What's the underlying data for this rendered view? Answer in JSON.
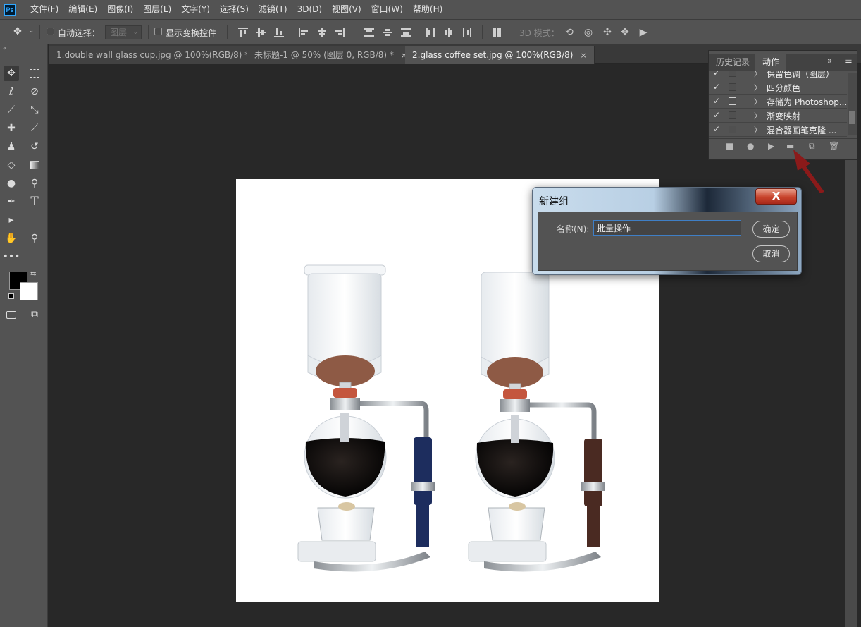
{
  "menubar": {
    "logo": "Ps",
    "items": [
      "文件(F)",
      "编辑(E)",
      "图像(I)",
      "图层(L)",
      "文字(Y)",
      "选择(S)",
      "滤镜(T)",
      "3D(D)",
      "视图(V)",
      "窗口(W)",
      "帮助(H)"
    ]
  },
  "options": {
    "auto_select_label": "自动选择：",
    "layer_select": "图层",
    "show_transform_label": "显示变换控件",
    "mode_3d_label": "3D 模式："
  },
  "tabs": [
    {
      "label": "1.double wall glass cup.jpg @ 100%(RGB/8) *",
      "close": "×"
    },
    {
      "label": "未标题-1 @ 50% (图层 0, RGB/8) *",
      "close": "×"
    },
    {
      "label": "2.glass coffee set.jpg @ 100%(RGB/8)",
      "close": "×"
    }
  ],
  "actions_panel": {
    "tabs": [
      "历史记录",
      "动作"
    ],
    "menu_icon": "≡",
    "expand_icon": "»",
    "rows": [
      {
        "check": "✓",
        "chevron": "〉",
        "name": "保留色调（图层）"
      },
      {
        "check": "✓",
        "chevron": "〉",
        "name": "四分颜色"
      },
      {
        "check": "✓",
        "chevron": "〉",
        "name": "存储为 Photoshop..."
      },
      {
        "check": "✓",
        "chevron": "〉",
        "name": "渐变映射"
      },
      {
        "check": "✓",
        "chevron": "〉",
        "name": "混合器画笔克隆 ..."
      }
    ],
    "footer_icons": [
      "stop-icon",
      "record-icon",
      "play-icon",
      "folder-icon",
      "new-action-icon",
      "trash-icon"
    ]
  },
  "dialog": {
    "title": "新建组",
    "close": "X",
    "name_label": "名称(N):",
    "name_value": "批量操作",
    "ok_label": "确定",
    "cancel_label": "取消"
  },
  "colors": {
    "ui_panel": "#535353",
    "ui_dark": "#282828",
    "accent_red": "#8b1a1a",
    "ps_blue": "#31a8ff"
  }
}
